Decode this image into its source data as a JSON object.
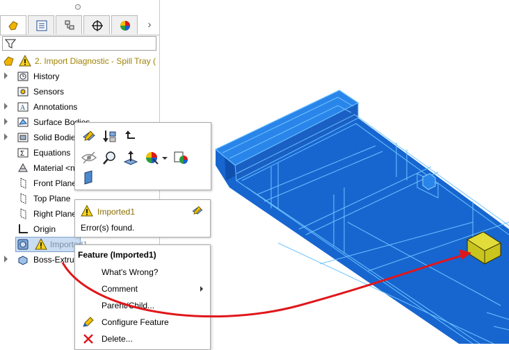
{
  "tree": {
    "root": "2. Import Diagnostic - Spill Tray  (",
    "items": [
      {
        "label": "History",
        "expandable": true
      },
      {
        "label": "Sensors",
        "expandable": false
      },
      {
        "label": "Annotations",
        "expandable": true
      },
      {
        "label": "Surface Bodies",
        "expandable": true
      },
      {
        "label": "Solid Bodies",
        "expandable": true
      },
      {
        "label": "Equations",
        "expandable": false
      },
      {
        "label": "Material <n",
        "expandable": false
      },
      {
        "label": "Front Plane",
        "expandable": false
      },
      {
        "label": "Top Plane",
        "expandable": false
      },
      {
        "label": "Right Plane",
        "expandable": false
      },
      {
        "label": "Origin",
        "expandable": false
      },
      {
        "label": "Imported1",
        "expandable": false
      },
      {
        "label": "Boss-Extrude",
        "expandable": true
      }
    ]
  },
  "tooltip": {
    "title": "Imported1",
    "body": "Error(s) found."
  },
  "context_menu": {
    "header": "Feature (Imported1)",
    "items": [
      {
        "label": "What's Wrong?",
        "submenu": false
      },
      {
        "label": "Comment",
        "submenu": true
      },
      {
        "label": "Parent/Child...",
        "submenu": false
      },
      {
        "label": "Configure Feature",
        "submenu": false
      },
      {
        "label": "Delete...",
        "submenu": false
      }
    ]
  },
  "colors": {
    "model_fill": "#1a6fd6",
    "model_edge": "#5fb8ff",
    "arrow": "#e0161b",
    "highlight": "#c9c41e"
  }
}
